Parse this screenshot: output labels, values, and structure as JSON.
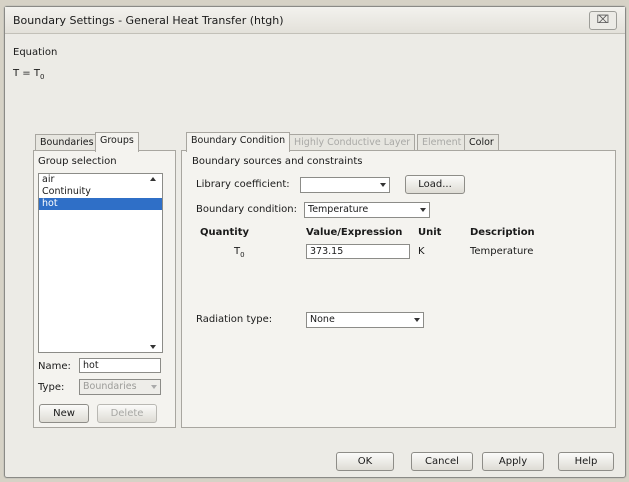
{
  "window": {
    "title": "Boundary Settings - General Heat Transfer (htgh)",
    "close_label": "⌧"
  },
  "equation": {
    "label": "Equation",
    "lhs": "T = T",
    "sub": "0"
  },
  "left_tabs": [
    "Boundaries",
    "Groups"
  ],
  "group_selection": {
    "label": "Group selection",
    "items": [
      "air",
      "Continuity",
      "hot"
    ],
    "selected": "hot"
  },
  "group_fields": {
    "name_label": "Name:",
    "name_value": "hot",
    "type_label": "Type:",
    "type_value": "Boundaries",
    "new_label": "New",
    "delete_label": "Delete"
  },
  "right_tabs": [
    "Boundary Condition",
    "Highly Conductive Layer",
    "Element",
    "Color"
  ],
  "boundary_condition": {
    "section_label": "Boundary sources and constraints",
    "library_label": "Library coefficient:",
    "library_value": "",
    "load_label": "Load...",
    "bc_label": "Boundary condition:",
    "bc_value": "Temperature",
    "table_headers": {
      "quantity": "Quantity",
      "value": "Value/Expression",
      "unit": "Unit",
      "description": "Description"
    },
    "rows": [
      {
        "quantity": "T",
        "quantity_sub": "0",
        "value": "373.15",
        "unit": "K",
        "description": "Temperature"
      }
    ],
    "radiation_label": "Radiation type:",
    "radiation_value": "None"
  },
  "footer_buttons": [
    "OK",
    "Cancel",
    "Apply",
    "Help"
  ]
}
